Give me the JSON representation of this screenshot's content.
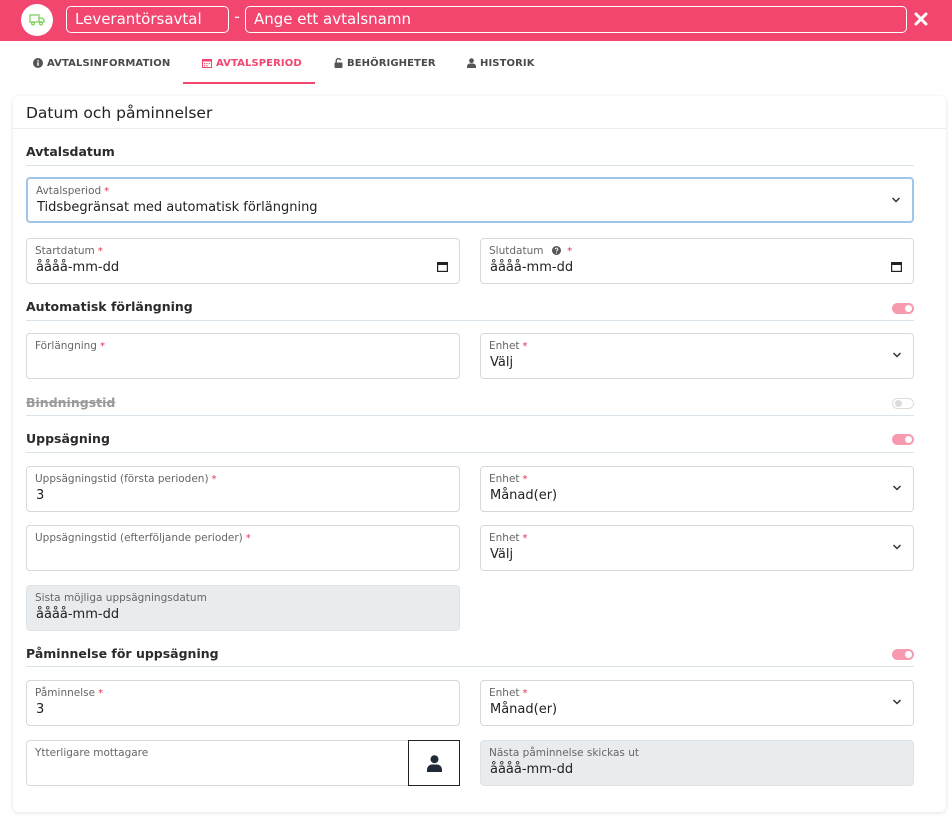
{
  "header": {
    "type_value": "Leverantörsavtal",
    "dash": "-",
    "name_placeholder": "Ange ett avtalsnamn",
    "bg_color": "#f2466f"
  },
  "tabs": [
    {
      "label": "AVTALSINFORMATION",
      "icon": "info-circle-icon",
      "active": false
    },
    {
      "label": "AVTALSPERIOD",
      "icon": "calendar-icon",
      "active": true
    },
    {
      "label": "BEHÖRIGHETER",
      "icon": "unlock-icon",
      "active": false
    },
    {
      "label": "HISTORIK",
      "icon": "user-icon",
      "active": false
    }
  ],
  "card": {
    "title": "Datum och påminnelser"
  },
  "sections": {
    "avtalsdatum": {
      "title": "Avtalsdatum",
      "period": {
        "label": "Avtalsperiod",
        "value": "Tidsbegränsat med automatisk förlängning"
      },
      "start": {
        "label": "Startdatum",
        "value": "åååå-mm-dd"
      },
      "end": {
        "label": "Slutdatum",
        "value": "åååå-mm-dd"
      }
    },
    "forlangning": {
      "title": "Automatisk förlängning",
      "enabled": true,
      "amount": {
        "label": "Förlängning",
        "value": ""
      },
      "unit": {
        "label": "Enhet",
        "value": "Välj"
      }
    },
    "bindningstid": {
      "title": "Bindningstid",
      "enabled": false
    },
    "uppsagning": {
      "title": "Uppsägning",
      "enabled": true,
      "first": {
        "label": "Uppsägningstid (första perioden)",
        "value": "3"
      },
      "first_unit": {
        "label": "Enhet",
        "value": "Månad(er)"
      },
      "following": {
        "label": "Uppsägningstid (efterföljande perioder)",
        "value": ""
      },
      "following_unit": {
        "label": "Enhet",
        "value": "Välj"
      },
      "last_date": {
        "label": "Sista möjliga uppsägningsdatum",
        "value": "åååå-mm-dd"
      }
    },
    "paminnelse": {
      "title": "Påminnelse för uppsägning",
      "enabled": true,
      "reminder": {
        "label": "Påminnelse",
        "value": "3"
      },
      "reminder_unit": {
        "label": "Enhet",
        "value": "Månad(er)"
      },
      "recipients": {
        "label": "Ytterligare mottagare",
        "value": ""
      },
      "next": {
        "label": "Nästa påminnelse skickas ut",
        "value": "åååå-mm-dd"
      }
    }
  },
  "required_mark": "*"
}
